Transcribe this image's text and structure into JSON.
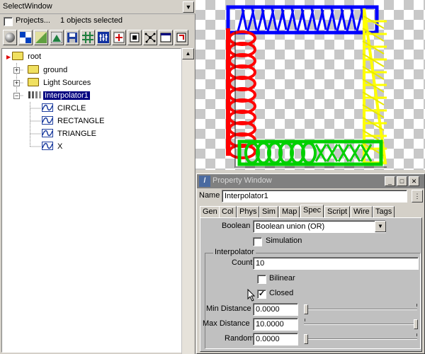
{
  "select_window": {
    "title": "SelectWindow",
    "projects_label": "Projects...",
    "projects_checked": false,
    "selection_status": "1 objects selected",
    "toolbar_icons": [
      "sphere-icon",
      "checker-icon",
      "gradient-icon",
      "image-icon",
      "save-icon",
      "grid-icon",
      "equalizer-icon",
      "plus-box-icon",
      "node-icon",
      "graph-icon",
      "window-icon",
      "frame-icon"
    ]
  },
  "tree": {
    "root": "root",
    "ground": "ground",
    "light_sources": "Light Sources",
    "interpolator": "Interpolator1",
    "children": [
      "CIRCLE",
      "RECTANGLE",
      "TRIANGLE",
      "X"
    ]
  },
  "property_window": {
    "title": "Property Window",
    "name_label": "Name",
    "name_value": "Interpolator1",
    "tabs": [
      "Gen",
      "Col",
      "Phys",
      "Sim",
      "Map",
      "Spec",
      "Script",
      "Wire",
      "Tags"
    ],
    "active_tab": "Spec",
    "boolean_label": "Boolean",
    "boolean_value": "Boolean union (OR)",
    "simulation_label": "Simulation",
    "simulation_checked": false,
    "interpolator_group": "Interpolator",
    "count_label": "Count",
    "count_value": "10",
    "bilinear_label": "Bilinear",
    "bilinear_checked": false,
    "closed_label": "Closed",
    "closed_checked": true,
    "min_distance_label": "Min Distance",
    "min_distance_value": "0.0000",
    "min_distance_slider": 0.0,
    "max_distance_label": "Max Distance",
    "max_distance_value": "10.0000",
    "max_distance_slider": 1.0,
    "random_label": "Random",
    "random_value": "0.0000",
    "random_slider": 0.0
  },
  "colors": {
    "interp_blue": "#0000ff",
    "interp_red": "#ff0000",
    "interp_yellow": "#ffff00",
    "interp_green": "#00e000",
    "selection": "#000080"
  }
}
